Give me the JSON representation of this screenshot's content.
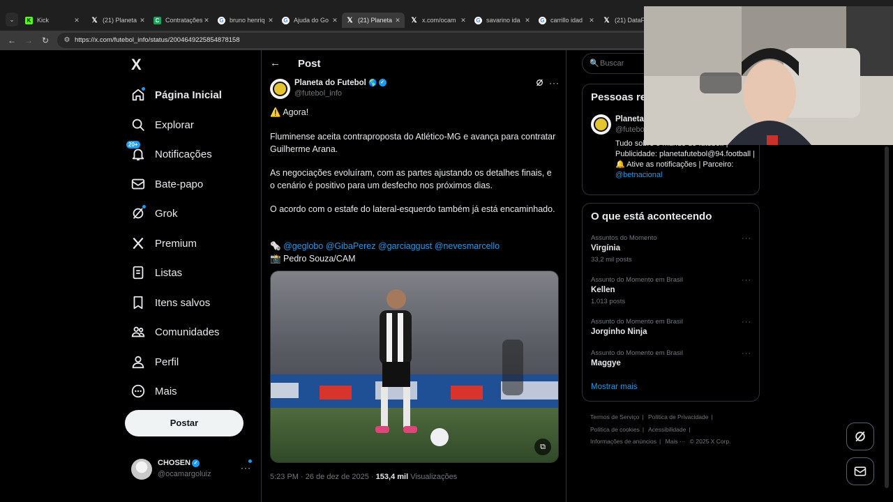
{
  "browser": {
    "tabs": [
      {
        "title": "Kick",
        "favicon": "kick-icon"
      },
      {
        "title": "(21) Planeta",
        "favicon": "x-icon"
      },
      {
        "title": "Contratações",
        "favicon": "contratacoes-icon"
      },
      {
        "title": "bruno henriq",
        "favicon": "google-icon"
      },
      {
        "title": "Ajuda do Go",
        "favicon": "google-icon"
      },
      {
        "title": "(21) Planeta",
        "favicon": "x-icon"
      },
      {
        "title": "x.com/ocam",
        "favicon": "x-icon"
      },
      {
        "title": "savarino ida",
        "favicon": "google-icon"
      },
      {
        "title": "carrillo idad",
        "favicon": "google-icon"
      },
      {
        "title": "(21) DataFu",
        "favicon": "x-icon"
      }
    ],
    "url": "https://x.com/futebol_info/status/2004649225854878158"
  },
  "nav": {
    "logo": "X",
    "items": [
      {
        "label": "Página Inicial",
        "icon": "home-icon"
      },
      {
        "label": "Explorar",
        "icon": "search-icon"
      },
      {
        "label": "Notificações",
        "icon": "bell-icon",
        "badge": "20+"
      },
      {
        "label": "Bate-papo",
        "icon": "mail-icon"
      },
      {
        "label": "Grok",
        "icon": "grok-icon"
      },
      {
        "label": "Premium",
        "icon": "x-premium-icon"
      },
      {
        "label": "Listas",
        "icon": "list-icon"
      },
      {
        "label": "Itens salvos",
        "icon": "bookmark-icon"
      },
      {
        "label": "Comunidades",
        "icon": "communities-icon"
      },
      {
        "label": "Perfil",
        "icon": "person-icon"
      },
      {
        "label": "Mais",
        "icon": "more-circle-icon"
      }
    ],
    "post_button": "Postar",
    "account": {
      "name": "CHOSEN",
      "handle": "@ocamargoluiz"
    }
  },
  "post": {
    "header": "Post",
    "author": {
      "name": "Planeta do Futebol",
      "handle": "@futebol_info"
    },
    "lines": {
      "alert": "⚠️ Agora!",
      "p1": "Fluminense aceita contraproposta do Atlético-MG e avança para contratar Guilherme Arana.",
      "p2": "As negociações evoluíram, com as partes ajustando os detalhes finais, e o cenário é positivo para um desfecho nos próximos dias.",
      "p3": "O acordo com o estafe do lateral-esquerdo também já está encaminhado.",
      "mentions_prefix": "🗞️",
      "mentions": [
        "@geglobo",
        "@GibaPerez",
        "@garciaggust",
        "@nevesmarcello"
      ],
      "photo_credit": "📸 Pedro Souza/CAM"
    },
    "meta": {
      "time": "5:23 PM · 26 de dez de 2025 ·",
      "views": "153,4 mil",
      "views_label": "Visualizações"
    }
  },
  "right": {
    "search_placeholder": "Buscar",
    "who_to_follow": {
      "title": "Pessoas re",
      "name": "Planeta",
      "handle": "@futebo",
      "bio": "Tudo sobre o mundo do futebol. | Publicidade: planetafutebol@94.football | 🔔 Ative as notificações | Parceiro:",
      "bio_link": "@betnacional"
    },
    "trends": {
      "title": "O que está acontecendo",
      "items": [
        {
          "context": "Assuntos do Momento",
          "name": "Virgínia",
          "count": "33,2 mil posts"
        },
        {
          "context": "Assunto do Momento em Brasil",
          "name": "Kellen",
          "count": "1.013 posts"
        },
        {
          "context": "Assunto do Momento em Brasil",
          "name": "Jorginho Ninja",
          "count": ""
        },
        {
          "context": "Assunto do Momento em Brasil",
          "name": "Maggye",
          "count": ""
        }
      ],
      "show_more": "Mostrar mais"
    },
    "footer": [
      "Termos de Serviço",
      "|",
      "Política de Privacidade",
      "|",
      "Política de cookies",
      "|",
      "Acessibilidade",
      "|",
      "Informações de anúncios",
      "|",
      "Mais ···",
      "© 2025 X Corp."
    ]
  },
  "colors": {
    "accent": "#1d9bf0",
    "background": "#000000",
    "text": "#e7e9ea",
    "muted": "#71767b"
  }
}
